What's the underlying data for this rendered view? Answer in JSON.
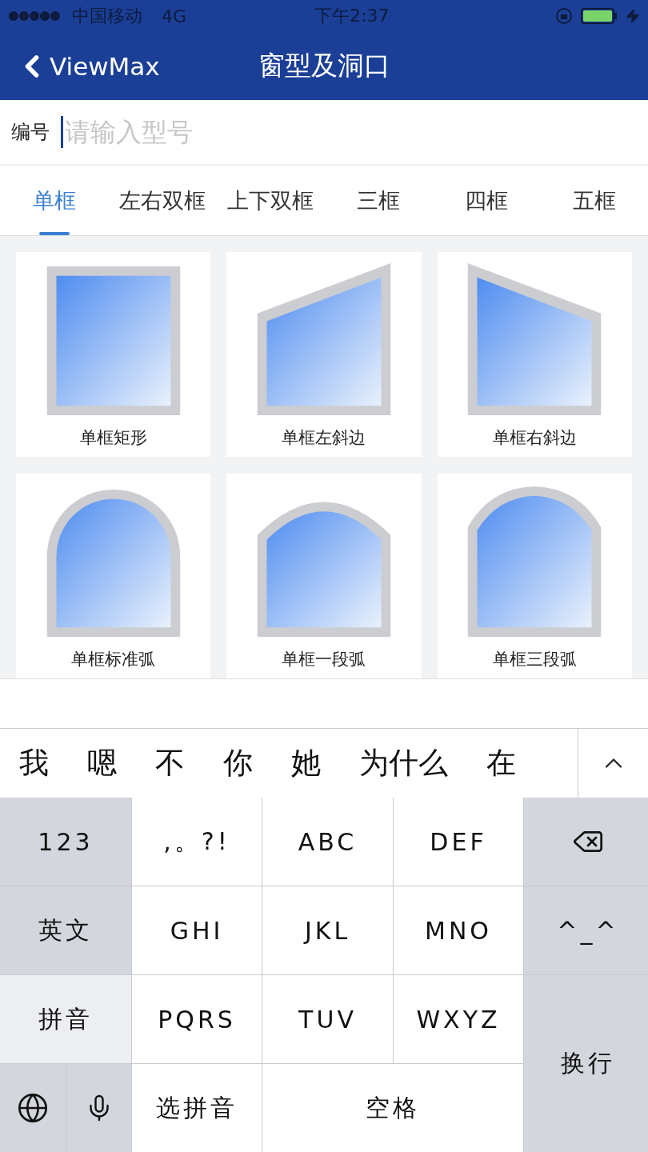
{
  "status_bar": {
    "carrier": "中国移动",
    "network": "4G",
    "time": "下午2:37"
  },
  "nav_bar": {
    "back": "ViewMax",
    "title": "窗型及洞口"
  },
  "search": {
    "label": "编号",
    "placeholder": "请输入型号"
  },
  "tabs": [
    {
      "label": "单框",
      "selected": true
    },
    {
      "label": "左右双框",
      "selected": false
    },
    {
      "label": "上下双框",
      "selected": false
    },
    {
      "label": "三框",
      "selected": false
    },
    {
      "label": "四框",
      "selected": false
    },
    {
      "label": "五框",
      "selected": false
    }
  ],
  "shapes": [
    {
      "kind": "rect",
      "label": "单框矩形"
    },
    {
      "kind": "left-slope",
      "label": "单框左斜边"
    },
    {
      "kind": "right-slope",
      "label": "单框右斜边"
    },
    {
      "kind": "standard-arc",
      "label": "单框标准弧"
    },
    {
      "kind": "one-arc",
      "label": "单框一段弧"
    },
    {
      "kind": "three-arc",
      "label": "单框三段弧"
    }
  ],
  "keyboard": {
    "candidates": [
      "我",
      "嗯",
      "不",
      "你",
      "她",
      "为什么",
      "在"
    ],
    "mode_keys": [
      {
        "label": "123",
        "selected": false
      },
      {
        "label": "英文",
        "selected": false
      },
      {
        "label": "拼音",
        "selected": true
      }
    ],
    "letter_rows": [
      [
        ",。?!",
        "ABC",
        "DEF"
      ],
      [
        "GHI",
        "JKL",
        "MNO"
      ],
      [
        "PQRS",
        "TUV",
        "WXYZ"
      ]
    ],
    "emoji_key": "^_^",
    "choose_key": "选拼音",
    "space_key": "空格",
    "return_key": "换行"
  }
}
